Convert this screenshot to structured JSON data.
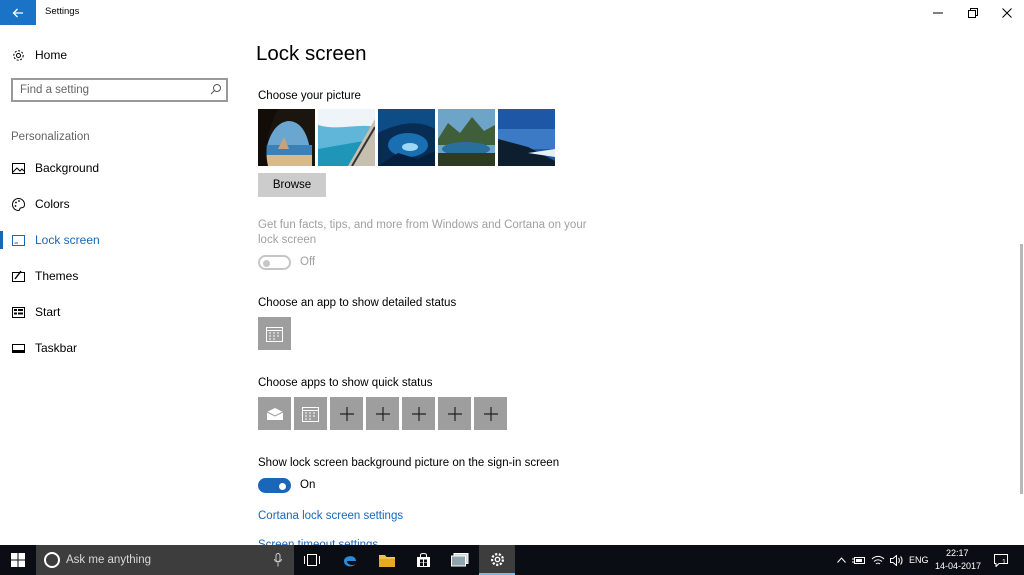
{
  "window": {
    "title": "Settings",
    "back_icon": "arrow-left-icon",
    "controls": [
      "minimize-icon",
      "restore-icon",
      "close-icon"
    ]
  },
  "sidebar": {
    "home_label": "Home",
    "search_placeholder": "Find a setting",
    "section_label": "Personalization",
    "items": [
      {
        "label": "Background",
        "icon": "picture-icon",
        "active": false
      },
      {
        "label": "Colors",
        "icon": "palette-icon",
        "active": false
      },
      {
        "label": "Lock screen",
        "icon": "lock-screen-icon",
        "active": true
      },
      {
        "label": "Themes",
        "icon": "themes-icon",
        "active": false
      },
      {
        "label": "Start",
        "icon": "start-menu-icon",
        "active": false
      },
      {
        "label": "Taskbar",
        "icon": "taskbar-icon",
        "active": false
      }
    ]
  },
  "main": {
    "title": "Lock screen",
    "choose_picture_heading": "Choose your picture",
    "pictures": [
      "cave-beach",
      "beach-aerial",
      "ice-cave",
      "mountain-lake",
      "mountain-sky"
    ],
    "browse_label": "Browse",
    "fun_facts_text": "Get fun facts, tips, and more from Windows and Cortana on your lock screen",
    "fun_facts_toggle": {
      "state": "Off",
      "enabled": false
    },
    "detailed_status_heading": "Choose an app to show detailed status",
    "detailed_status_app": "calendar-icon",
    "quick_status_heading": "Choose apps to show quick status",
    "quick_status_apps": [
      "mail-icon",
      "calendar-icon",
      "plus-icon",
      "plus-icon",
      "plus-icon",
      "plus-icon",
      "plus-icon"
    ],
    "signin_heading": "Show lock screen background picture on the sign-in screen",
    "signin_toggle": {
      "state": "On",
      "enabled": true
    },
    "cortana_link": "Cortana lock screen settings",
    "timeout_link": "Screen timeout settings"
  },
  "taskbar": {
    "search_placeholder": "Ask me anything",
    "apps": [
      "task-view-icon",
      "edge-icon",
      "file-explorer-icon",
      "store-icon",
      "photos-icon",
      "settings-icon"
    ],
    "language": "ENG",
    "time": "22:17",
    "date": "14-04-2017",
    "notification_count": "1"
  },
  "colors": {
    "accent": "#1a66b8",
    "back_button": "#1a73c7",
    "tile": "#9e9e9e",
    "taskbar": "#0a0d13"
  }
}
